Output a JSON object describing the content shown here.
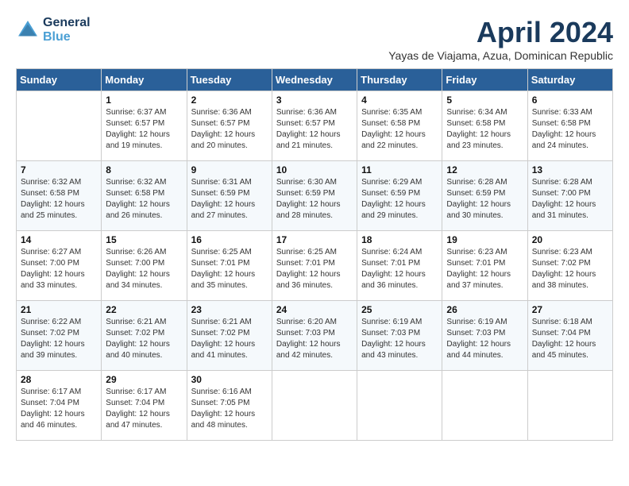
{
  "header": {
    "logo_line1": "General",
    "logo_line2": "Blue",
    "month_title": "April 2024",
    "subtitle": "Yayas de Viajama, Azua, Dominican Republic"
  },
  "weekdays": [
    "Sunday",
    "Monday",
    "Tuesday",
    "Wednesday",
    "Thursday",
    "Friday",
    "Saturday"
  ],
  "weeks": [
    [
      {
        "day": "",
        "empty": true
      },
      {
        "day": "1",
        "sunrise": "6:37 AM",
        "sunset": "6:57 PM",
        "daylight": "12 hours and 19 minutes."
      },
      {
        "day": "2",
        "sunrise": "6:36 AM",
        "sunset": "6:57 PM",
        "daylight": "12 hours and 20 minutes."
      },
      {
        "day": "3",
        "sunrise": "6:36 AM",
        "sunset": "6:57 PM",
        "daylight": "12 hours and 21 minutes."
      },
      {
        "day": "4",
        "sunrise": "6:35 AM",
        "sunset": "6:58 PM",
        "daylight": "12 hours and 22 minutes."
      },
      {
        "day": "5",
        "sunrise": "6:34 AM",
        "sunset": "6:58 PM",
        "daylight": "12 hours and 23 minutes."
      },
      {
        "day": "6",
        "sunrise": "6:33 AM",
        "sunset": "6:58 PM",
        "daylight": "12 hours and 24 minutes."
      }
    ],
    [
      {
        "day": "7",
        "sunrise": "6:32 AM",
        "sunset": "6:58 PM",
        "daylight": "12 hours and 25 minutes."
      },
      {
        "day": "8",
        "sunrise": "6:32 AM",
        "sunset": "6:58 PM",
        "daylight": "12 hours and 26 minutes."
      },
      {
        "day": "9",
        "sunrise": "6:31 AM",
        "sunset": "6:59 PM",
        "daylight": "12 hours and 27 minutes."
      },
      {
        "day": "10",
        "sunrise": "6:30 AM",
        "sunset": "6:59 PM",
        "daylight": "12 hours and 28 minutes."
      },
      {
        "day": "11",
        "sunrise": "6:29 AM",
        "sunset": "6:59 PM",
        "daylight": "12 hours and 29 minutes."
      },
      {
        "day": "12",
        "sunrise": "6:28 AM",
        "sunset": "6:59 PM",
        "daylight": "12 hours and 30 minutes."
      },
      {
        "day": "13",
        "sunrise": "6:28 AM",
        "sunset": "7:00 PM",
        "daylight": "12 hours and 31 minutes."
      }
    ],
    [
      {
        "day": "14",
        "sunrise": "6:27 AM",
        "sunset": "7:00 PM",
        "daylight": "12 hours and 33 minutes."
      },
      {
        "day": "15",
        "sunrise": "6:26 AM",
        "sunset": "7:00 PM",
        "daylight": "12 hours and 34 minutes."
      },
      {
        "day": "16",
        "sunrise": "6:25 AM",
        "sunset": "7:01 PM",
        "daylight": "12 hours and 35 minutes."
      },
      {
        "day": "17",
        "sunrise": "6:25 AM",
        "sunset": "7:01 PM",
        "daylight": "12 hours and 36 minutes."
      },
      {
        "day": "18",
        "sunrise": "6:24 AM",
        "sunset": "7:01 PM",
        "daylight": "12 hours and 36 minutes."
      },
      {
        "day": "19",
        "sunrise": "6:23 AM",
        "sunset": "7:01 PM",
        "daylight": "12 hours and 37 minutes."
      },
      {
        "day": "20",
        "sunrise": "6:23 AM",
        "sunset": "7:02 PM",
        "daylight": "12 hours and 38 minutes."
      }
    ],
    [
      {
        "day": "21",
        "sunrise": "6:22 AM",
        "sunset": "7:02 PM",
        "daylight": "12 hours and 39 minutes."
      },
      {
        "day": "22",
        "sunrise": "6:21 AM",
        "sunset": "7:02 PM",
        "daylight": "12 hours and 40 minutes."
      },
      {
        "day": "23",
        "sunrise": "6:21 AM",
        "sunset": "7:02 PM",
        "daylight": "12 hours and 41 minutes."
      },
      {
        "day": "24",
        "sunrise": "6:20 AM",
        "sunset": "7:03 PM",
        "daylight": "12 hours and 42 minutes."
      },
      {
        "day": "25",
        "sunrise": "6:19 AM",
        "sunset": "7:03 PM",
        "daylight": "12 hours and 43 minutes."
      },
      {
        "day": "26",
        "sunrise": "6:19 AM",
        "sunset": "7:03 PM",
        "daylight": "12 hours and 44 minutes."
      },
      {
        "day": "27",
        "sunrise": "6:18 AM",
        "sunset": "7:04 PM",
        "daylight": "12 hours and 45 minutes."
      }
    ],
    [
      {
        "day": "28",
        "sunrise": "6:17 AM",
        "sunset": "7:04 PM",
        "daylight": "12 hours and 46 minutes."
      },
      {
        "day": "29",
        "sunrise": "6:17 AM",
        "sunset": "7:04 PM",
        "daylight": "12 hours and 47 minutes."
      },
      {
        "day": "30",
        "sunrise": "6:16 AM",
        "sunset": "7:05 PM",
        "daylight": "12 hours and 48 minutes."
      },
      {
        "day": "",
        "empty": true
      },
      {
        "day": "",
        "empty": true
      },
      {
        "day": "",
        "empty": true
      },
      {
        "day": "",
        "empty": true
      }
    ]
  ],
  "labels": {
    "sunrise": "Sunrise:",
    "sunset": "Sunset:",
    "daylight": "Daylight:"
  }
}
